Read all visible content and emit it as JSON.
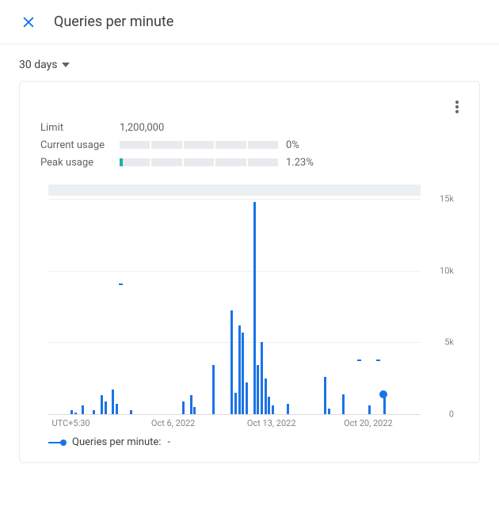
{
  "header": {
    "title": "Queries per minute"
  },
  "controls": {
    "range_label": "30 days"
  },
  "stats": {
    "limit_label": "Limit",
    "limit_value": "1,200,000",
    "current_label": "Current usage",
    "current_value": "0%",
    "current_pct": 0,
    "peak_label": "Peak usage",
    "peak_value": "1.23%",
    "peak_pct": 1.23
  },
  "legend": {
    "series_label": "Queries per minute:",
    "series_value": "-"
  },
  "chart_data": {
    "type": "bar",
    "title": "Queries per minute",
    "xlabel": "UTC+5:30",
    "ylabel": "",
    "ylim": [
      0,
      15000
    ],
    "y_ticks": [
      0,
      5000,
      10000,
      15000
    ],
    "y_tick_labels": [
      "0",
      "5k",
      "10k",
      "15k"
    ],
    "x_tick_labels": [
      "UTC+5:30",
      "Oct 6, 2022",
      "Oct 13, 2022",
      "Oct 20, 2022"
    ],
    "x_tick_positions_pct": [
      3,
      30,
      56,
      82
    ],
    "series": [
      {
        "name": "Queries per minute",
        "points": [
          {
            "x_pct": 6,
            "value": 250
          },
          {
            "x_pct": 7,
            "value": 120
          },
          {
            "x_pct": 9,
            "value": 600
          },
          {
            "x_pct": 12,
            "value": 300
          },
          {
            "x_pct": 14,
            "value": 1300
          },
          {
            "x_pct": 15,
            "value": 900
          },
          {
            "x_pct": 17,
            "value": 1700
          },
          {
            "x_pct": 18,
            "value": 700
          },
          {
            "x_pct": 19,
            "value": 9000,
            "style": "mark"
          },
          {
            "x_pct": 22,
            "value": 300
          },
          {
            "x_pct": 36,
            "value": 900
          },
          {
            "x_pct": 38,
            "value": 1300
          },
          {
            "x_pct": 39,
            "value": 500
          },
          {
            "x_pct": 44,
            "value": 3400
          },
          {
            "x_pct": 49,
            "value": 7200
          },
          {
            "x_pct": 50,
            "value": 1500
          },
          {
            "x_pct": 51,
            "value": 6200
          },
          {
            "x_pct": 52,
            "value": 5700
          },
          {
            "x_pct": 53,
            "value": 2200
          },
          {
            "x_pct": 55,
            "value": 14800
          },
          {
            "x_pct": 56,
            "value": 3400
          },
          {
            "x_pct": 57,
            "value": 5000
          },
          {
            "x_pct": 58,
            "value": 2500
          },
          {
            "x_pct": 59,
            "value": 1200
          },
          {
            "x_pct": 60,
            "value": 600
          },
          {
            "x_pct": 64,
            "value": 700
          },
          {
            "x_pct": 74,
            "value": 2600
          },
          {
            "x_pct": 75,
            "value": 400
          },
          {
            "x_pct": 79,
            "value": 1400
          },
          {
            "x_pct": 83,
            "value": 3700,
            "style": "mark"
          },
          {
            "x_pct": 86,
            "value": 600
          },
          {
            "x_pct": 88,
            "value": 3700,
            "style": "mark"
          },
          {
            "x_pct": 90,
            "value": 1400,
            "style": "cursor"
          }
        ]
      }
    ]
  }
}
